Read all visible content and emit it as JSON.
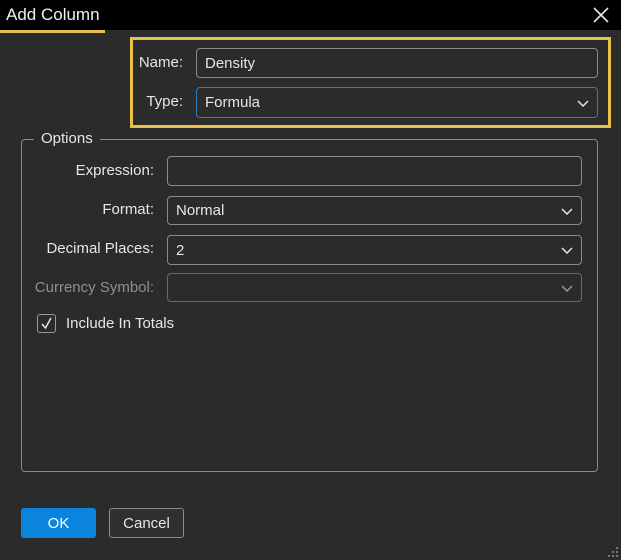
{
  "dialog": {
    "title": "Add Column",
    "close_icon": "close-icon"
  },
  "header": {
    "name_label": "Name:",
    "name_value": "Density",
    "type_label": "Type:",
    "type_value": "Formula"
  },
  "options": {
    "legend": "Options",
    "expression_label": "Expression:",
    "expression_value": "",
    "format_label": "Format:",
    "format_value": "Normal",
    "decimal_label": "Decimal Places:",
    "decimal_value": "2",
    "currency_label": "Currency Symbol:",
    "currency_value": "",
    "include_totals_label": "Include In Totals",
    "include_totals_checked": true
  },
  "buttons": {
    "ok": "OK",
    "cancel": "Cancel"
  },
  "colors": {
    "accent": "#0b84de",
    "highlight": "#e8c14a",
    "background": "#2b2b2b"
  }
}
